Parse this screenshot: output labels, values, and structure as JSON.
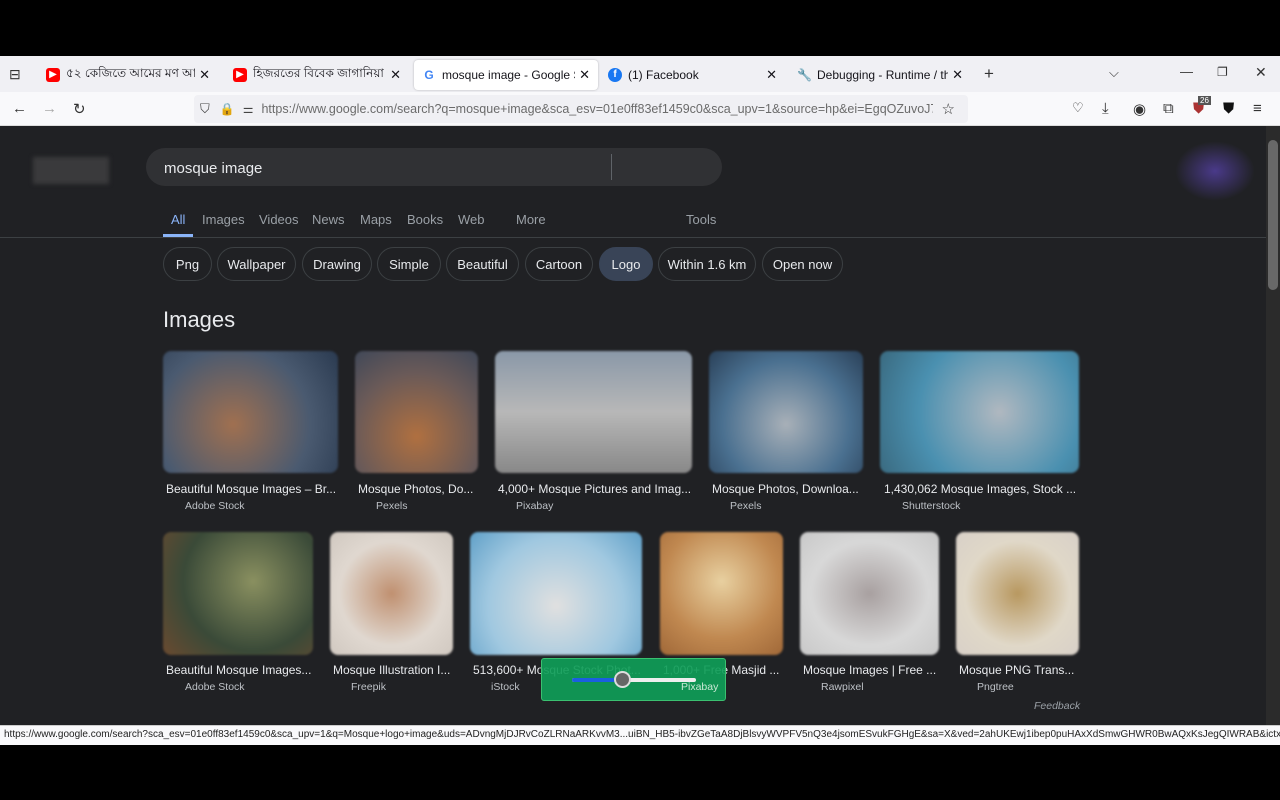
{
  "tabs": [
    {
      "title": "৫২ কেজিতে আমের মণ আড়তদ",
      "icon": "youtube-icon",
      "active": false
    },
    {
      "title": "হিজরতের বিবেক জাগানিয়া শিক্ষা",
      "icon": "youtube-icon",
      "active": false
    },
    {
      "title": "mosque image - Google Search",
      "icon": "google-icon",
      "active": true
    },
    {
      "title": "(1) Facebook",
      "icon": "facebook-icon",
      "active": false
    },
    {
      "title": "Debugging - Runtime / this-fire",
      "icon": "wrench-icon",
      "active": false
    }
  ],
  "url": "https://www.google.com/search?q=mosque+image&sca_esv=01e0ff83ef1459c0&sca_upv=1&source=hp&ei=EgqOZuvoJ7CYvr0Pue",
  "extension_badge": "26",
  "search": {
    "query": "mosque image"
  },
  "nav_tabs": [
    "All",
    "Images",
    "Videos",
    "News",
    "Maps",
    "Books",
    "Web",
    "More",
    "Tools"
  ],
  "chips": [
    "Png",
    "Wallpaper",
    "Drawing",
    "Simple",
    "Beautiful",
    "Cartoon",
    "Logo",
    "Within 1.6 km",
    "Open now"
  ],
  "section_title": "Images",
  "images_row1": [
    {
      "caption": "Beautiful Mosque Images – Br...",
      "source": "Adobe Stock"
    },
    {
      "caption": "Mosque Photos, Do...",
      "source": "Pexels"
    },
    {
      "caption": "4,000+ Mosque Pictures and Imag...",
      "source": "Pixabay"
    },
    {
      "caption": "Mosque Photos, Downloa...",
      "source": "Pexels"
    },
    {
      "caption": "1,430,062 Mosque Images, Stock ...",
      "source": "Shutterstock"
    }
  ],
  "images_row2": [
    {
      "caption": "Beautiful Mosque Images...",
      "source": "Adobe Stock"
    },
    {
      "caption": "Mosque Illustration I...",
      "source": "Freepik"
    },
    {
      "caption": "513,600+ Mosque Stock Phot...",
      "source": "iStock"
    },
    {
      "caption": "1,000+ Free Masjid ...",
      "source": "Pixabay"
    },
    {
      "caption": "Mosque Images | Free ...",
      "source": "Rawpixel"
    },
    {
      "caption": "Mosque PNG Trans...",
      "source": "Pngtree"
    }
  ],
  "feedback": "Feedback",
  "overlay_slider": {
    "value_percent": 40,
    "color": "#0f9d58"
  },
  "status_url": "https://www.google.com/search?sca_esv=01e0ff83ef1459c0&sca_upv=1&q=Mosque+logo+image&uds=ADvngMjDJRvCoZLRNaARKvvM3...uiBN_HB5-ibvZGeTaA8DjBlsvyWVPFV5nQ3e4jsomESvukFGHgE&sa=X&ved=2ahUKEwj1ibep0puHAxXdSmwGHWR0BwAQxKsJegQIWRAB&ictx=0"
}
